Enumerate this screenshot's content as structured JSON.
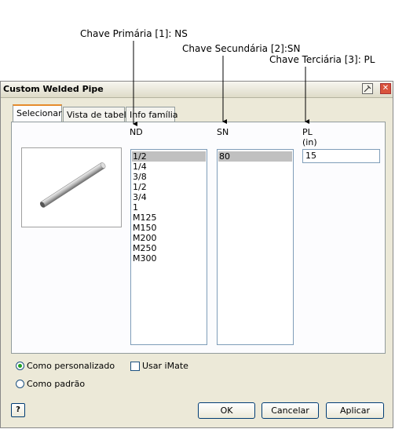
{
  "callouts": {
    "primary": "Chave Primária [1]: NS",
    "secondary": "Chave Secundária [2]:SN",
    "tertiary": "Chave Terciária [3]: PL"
  },
  "window": {
    "title": "Custom Welded Pipe",
    "pin_icon": "pin-icon",
    "close_icon": "close-icon"
  },
  "tabs": [
    {
      "label": "Selecionar",
      "active": true
    },
    {
      "label": "Vista de tabela",
      "active": false
    },
    {
      "label": "Info família",
      "active": false
    }
  ],
  "preview": {
    "icon": "pipe-preview-image"
  },
  "columns": {
    "nd": {
      "label": "ND",
      "items": [
        "1/2",
        "1/4",
        "3/8",
        "1/2",
        "3/4",
        "1",
        "M125",
        "M150",
        "M200",
        "M250",
        "M300"
      ],
      "selected_index": 0
    },
    "sn": {
      "label": "SN",
      "items": [
        "80"
      ],
      "selected_index": 0
    },
    "pl": {
      "label": "PL",
      "unit": "(in)",
      "value": "15"
    }
  },
  "options": {
    "radio_custom": {
      "label": "Como personalizado",
      "checked": true
    },
    "radio_standard": {
      "label": "Como padrão",
      "checked": false
    },
    "use_imate": {
      "label": "Usar iMate",
      "checked": false
    }
  },
  "buttons": {
    "help_icon": "help-icon",
    "ok": "OK",
    "cancel": "Cancelar",
    "apply": "Aplicar"
  }
}
